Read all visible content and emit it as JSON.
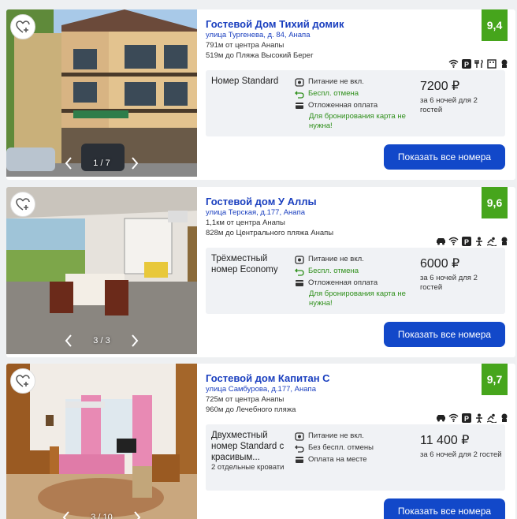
{
  "colors": {
    "link": "#1a3fbf",
    "rating_bg": "#46a51c",
    "button_bg": "#1248c9",
    "green_text": "#2e8f1a"
  },
  "listings": [
    {
      "title": "Гостевой Дом Тихий домик",
      "address": "улица Тургенева, д. 84, Анапа",
      "distance_center": "791м от центра Анапы",
      "distance_beach": "519м до Пляжа Высокий Берег",
      "rating": "9,4",
      "photo_counter": "1 / 7",
      "amenities": [
        "wifi-icon",
        "parking-icon",
        "restaurant-icon",
        "kitchen-icon",
        "chef-icon"
      ],
      "room_name": "Номер Standard",
      "room_note": "",
      "conditions": [
        {
          "icon": "meal-icon",
          "text": "Питание не вкл.",
          "style": "normal"
        },
        {
          "icon": "cancel-icon",
          "text": "Беспл. отмена",
          "style": "green"
        },
        {
          "icon": "card-icon",
          "text": "Отложенная оплата",
          "style": "normal"
        },
        {
          "icon": "",
          "text": "Для бронирования карта не нужна!",
          "style": "greenbold"
        }
      ],
      "price": "7200 ₽",
      "price_note": "за 6 ночей для 2 гостей",
      "button_label": "Показать все номера"
    },
    {
      "title": "Гостевой дом У Аллы",
      "address": "улица Терская, д.177, Анапа",
      "distance_center": "1,1км от центра Анапы",
      "distance_beach": "828м до Центрального пляжа Анапы",
      "rating": "9,6",
      "photo_counter": "3 / 3",
      "amenities": [
        "car-icon",
        "wifi-icon",
        "parking-icon",
        "kids-icon",
        "pool-icon",
        "chef-icon"
      ],
      "room_name": "Трёхместный номер Economy",
      "room_note": "",
      "conditions": [
        {
          "icon": "meal-icon",
          "text": "Питание не вкл.",
          "style": "normal"
        },
        {
          "icon": "cancel-icon",
          "text": "Беспл. отмена",
          "style": "green"
        },
        {
          "icon": "card-icon",
          "text": "Отложенная оплата",
          "style": "normal"
        },
        {
          "icon": "",
          "text": "Для бронирования карта не нужна!",
          "style": "greenbold"
        }
      ],
      "price": "6000 ₽",
      "price_note": "за 6 ночей для 2 гостей",
      "button_label": "Показать все номера"
    },
    {
      "title": "Гостевой дом Капитан С",
      "address": "улица Самбурова, д.177, Анапа",
      "distance_center": "725м от центра Анапы",
      "distance_beach": "960м до Лечебного пляжа",
      "rating": "9,7",
      "photo_counter": "3 / 10",
      "amenities": [
        "car-icon",
        "wifi-icon",
        "parking-icon",
        "kids-icon",
        "pool-icon",
        "chef-icon"
      ],
      "room_name": "Двухместный номер Standard с красивым...",
      "room_note": "2 отдельные кровати",
      "conditions": [
        {
          "icon": "meal-icon",
          "text": "Питание не вкл.",
          "style": "normal"
        },
        {
          "icon": "cancel-icon",
          "text": "Без беспл. отмены",
          "style": "normal"
        },
        {
          "icon": "card-icon",
          "text": "Оплата на месте",
          "style": "normal"
        }
      ],
      "price": "11 400 ₽",
      "price_note": "за 6 ночей для 2 гостей",
      "button_label": "Показать все номера"
    }
  ]
}
